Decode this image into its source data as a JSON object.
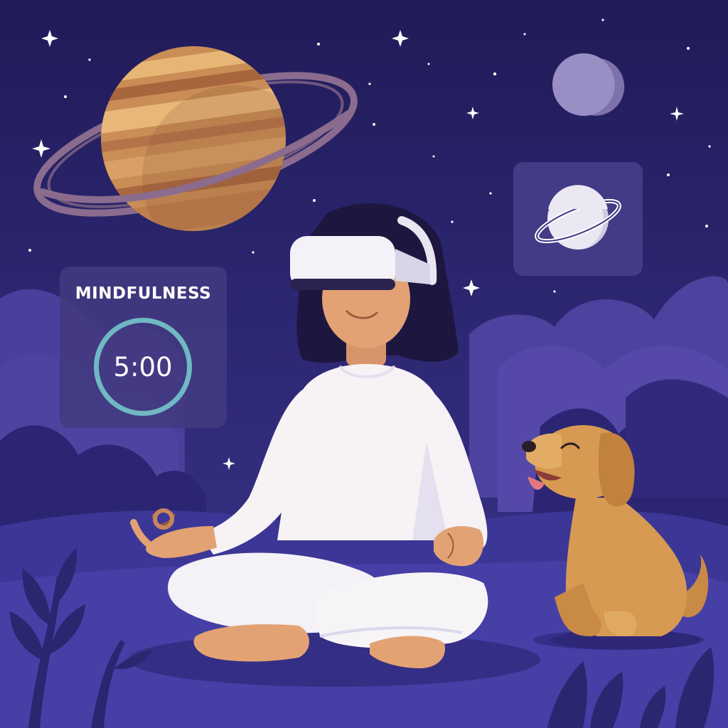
{
  "mindfulness_panel": {
    "title": "MINDFULNESS",
    "timer": "5:00",
    "ring_color": "#6fb8c4"
  },
  "environment_panel": {
    "icon": "planet-icon"
  },
  "palette": {
    "sky": "#231f5e",
    "panel": "#423a80",
    "saturn": "#d09a5c",
    "outfit": "#f7f3f5",
    "dog": "#d69a52"
  }
}
